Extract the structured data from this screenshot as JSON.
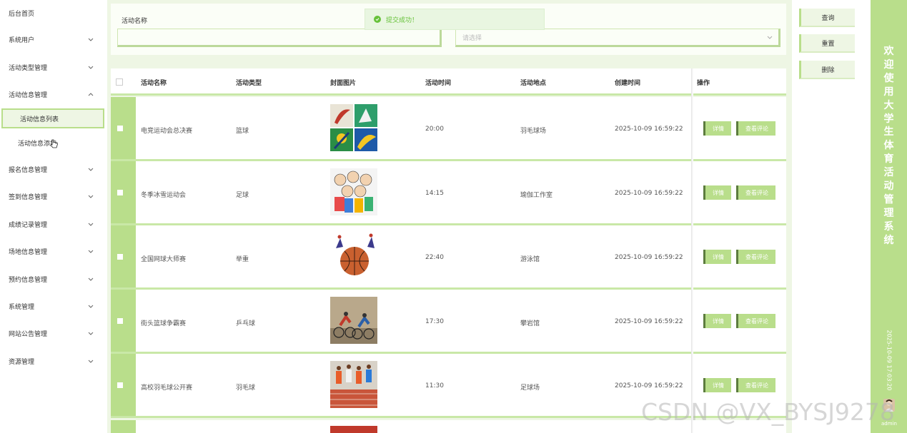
{
  "sidebar": {
    "items": [
      {
        "label": "后台首页",
        "chevron": false
      },
      {
        "label": "系统用户",
        "chevron": true
      },
      {
        "label": "活动类型管理",
        "chevron": true
      },
      {
        "label": "活动信息管理",
        "chevron": true,
        "expanded": true
      },
      {
        "label": "报名信息管理",
        "chevron": true
      },
      {
        "label": "签到信息管理",
        "chevron": true
      },
      {
        "label": "成绩记录管理",
        "chevron": true
      },
      {
        "label": "场地信息管理",
        "chevron": true
      },
      {
        "label": "预约信息管理",
        "chevron": true
      },
      {
        "label": "系统管理",
        "chevron": true
      },
      {
        "label": "网站公告管理",
        "chevron": true
      },
      {
        "label": "资源管理",
        "chevron": true
      }
    ],
    "subitems": [
      {
        "label": "活动信息列表",
        "active": true
      },
      {
        "label": "活动信息添加",
        "active": false
      }
    ]
  },
  "search": {
    "name_label": "活动名称",
    "name_value": "",
    "type_placeholder": "请选择"
  },
  "toast": {
    "message": "提交成功！"
  },
  "table": {
    "headers": [
      "活动名称",
      "活动类型",
      "封面图片",
      "活动时间",
      "活动地点",
      "创建时间",
      "操作"
    ],
    "rows": [
      {
        "name": "电竞运动会总决赛",
        "type": "篮球",
        "time": "20:00",
        "place": "羽毛球场",
        "created": "2025-10-09 16:59:22",
        "image": "sports-collage"
      },
      {
        "name": "冬季冰雪运动会",
        "type": "足球",
        "time": "14:15",
        "place": "瑜伽工作室",
        "created": "2025-10-09 16:59:22",
        "image": "cartoon-kids"
      },
      {
        "name": "全国网球大师赛",
        "type": "举重",
        "time": "22:40",
        "place": "游泳馆",
        "created": "2025-10-09 16:59:22",
        "image": "basketball"
      },
      {
        "name": "街头篮球争霸赛",
        "type": "乒乓球",
        "time": "17:30",
        "place": "攀岩馆",
        "created": "2025-10-09 16:59:22",
        "image": "cyclists"
      },
      {
        "name": "高校羽毛球公开赛",
        "type": "羽毛球",
        "time": "11:30",
        "place": "足球场",
        "created": "2025-10-09 16:59:22",
        "image": "runners"
      }
    ],
    "actions": {
      "detail": "详情",
      "comment": "查看评论"
    }
  },
  "buttons": {
    "query": "查询",
    "reset": "重置",
    "delete": "删除"
  },
  "title": {
    "chars": [
      "欢",
      "迎",
      "使",
      "用",
      "大",
      "学",
      "生",
      "体",
      "育",
      "活",
      "动",
      "管",
      "理",
      "系",
      "统"
    ],
    "datetime": "2025-10-09 17:03:20",
    "user": "admin"
  },
  "watermark": "CSDN @VX_BYSJ9278",
  "colors": {
    "accent": "#b9de8b",
    "accent_dark": "#5c7c3e",
    "panel": "#eef6e4",
    "success": "#67c23a"
  }
}
